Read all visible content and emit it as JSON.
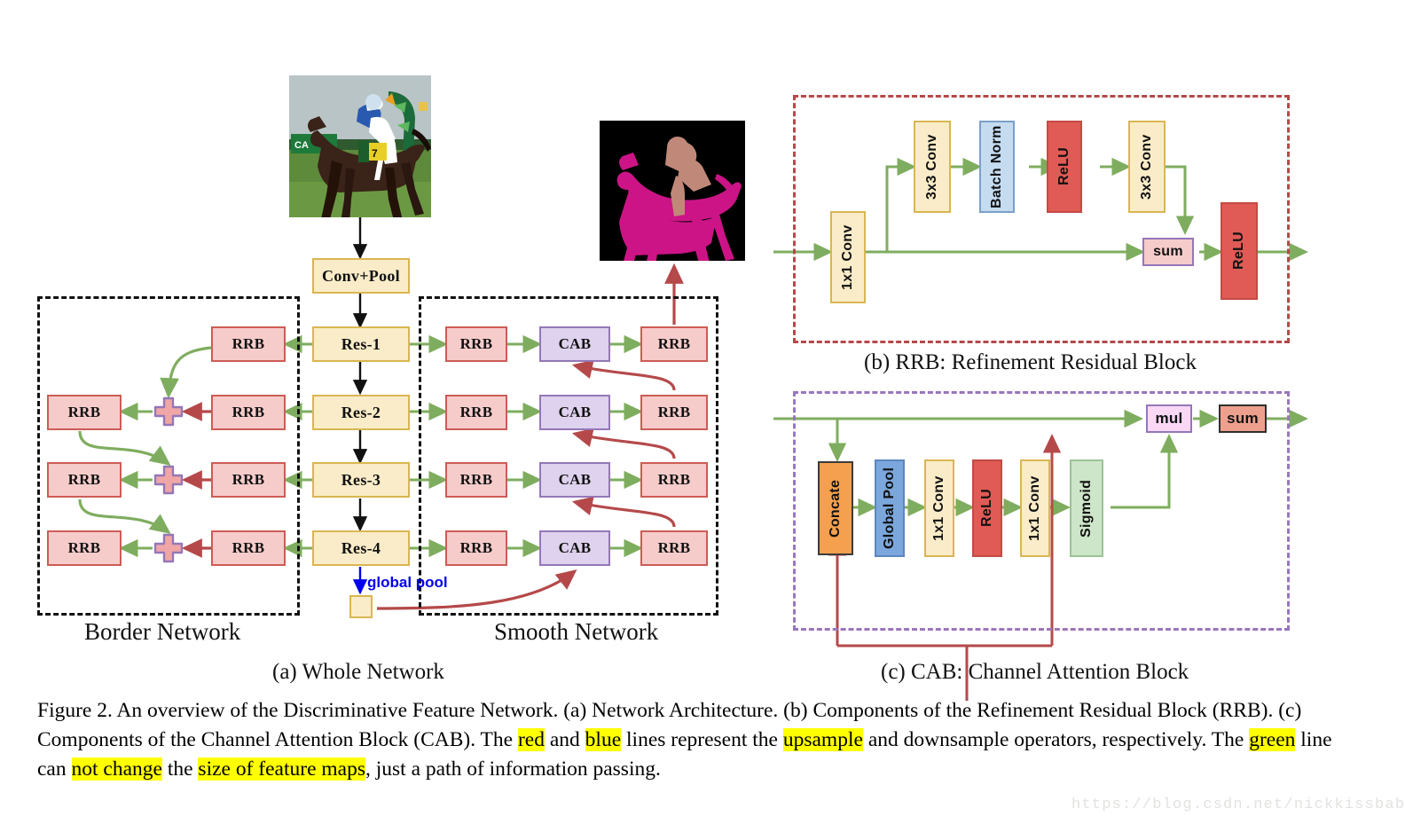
{
  "figure": {
    "caption_parts": [
      {
        "t": "Figure 2. An overview of the Discriminative Feature Network. (a) Network Architecture. (b) Components of the Refinement Residual Block (RRB). (c) Components of the Channel Attention Block (CAB). The ",
        "h": false
      },
      {
        "t": "red",
        "h": true
      },
      {
        "t": " and ",
        "h": false
      },
      {
        "t": "blue",
        "h": true
      },
      {
        "t": " lines represent the ",
        "h": false
      },
      {
        "t": "upsample",
        "h": true
      },
      {
        "t": " and downsample operators, respectively. The ",
        "h": false
      },
      {
        "t": "green",
        "h": true
      },
      {
        "t": " line can ",
        "h": false
      },
      {
        "t": "not change",
        "h": true
      },
      {
        "t": " the ",
        "h": false
      },
      {
        "t": "size of feature maps",
        "h": true
      },
      {
        "t": ", just a path of information passing.",
        "h": false
      }
    ],
    "watermark": "https://blog.csdn.net/nickkissbaby_"
  },
  "panel_a": {
    "sub_caption": "(a) Whole Network",
    "border_network_label": "Border Network",
    "smooth_network_label": "Smooth Network",
    "global_pool_label": "global pool",
    "backbone": [
      {
        "label": "Conv+Pool"
      },
      {
        "label": "Res-1"
      },
      {
        "label": "Res-2"
      },
      {
        "label": "Res-3"
      },
      {
        "label": "Res-4"
      }
    ],
    "border_rrb_col_inner": [
      "RRB",
      "RRB",
      "RRB",
      "RRB"
    ],
    "border_rrb_col_outer": [
      "RRB",
      "RRB",
      "RRB"
    ],
    "sum_symbol": "+",
    "smooth_rows": [
      {
        "rrb_in": "RRB",
        "cab": "CAB",
        "rrb_out": "RRB"
      },
      {
        "rrb_in": "RRB",
        "cab": "CAB",
        "rrb_out": "RRB"
      },
      {
        "rrb_in": "RRB",
        "cab": "CAB",
        "rrb_out": "RRB"
      },
      {
        "rrb_in": "RRB",
        "cab": "CAB",
        "rrb_out": "RRB"
      }
    ],
    "input_image_alt": "horse-and-jockey-photo",
    "output_image_alt": "horse-and-jockey-segmentation-mask"
  },
  "panel_b": {
    "sub_caption": "(b) RRB: Refinement Residual Block",
    "blocks": [
      {
        "label": "1x1 Conv",
        "color": "#faecc8"
      },
      {
        "label": "3x3 Conv",
        "color": "#faecc8"
      },
      {
        "label": "Batch Norm",
        "color": "#c5dbf0"
      },
      {
        "label": "ReLU",
        "color": "#e05b55"
      },
      {
        "label": "3x3 Conv",
        "color": "#faecc8"
      },
      {
        "label": "sum",
        "color": "#f6cccb"
      },
      {
        "label": "ReLU",
        "color": "#e05b55"
      }
    ]
  },
  "panel_c": {
    "sub_caption": "(c) CAB: Channel Attention Block",
    "blocks": [
      {
        "label": "Concate",
        "color": "#f5a04e"
      },
      {
        "label": "Global Pool",
        "color": "#7ba7dc"
      },
      {
        "label": "1x1 Conv",
        "color": "#faecc8"
      },
      {
        "label": "ReLU",
        "color": "#e05b55"
      },
      {
        "label": "1x1 Conv",
        "color": "#faecc8"
      },
      {
        "label": "Sigmoid",
        "color": "#cde5c8"
      },
      {
        "label": "mul",
        "color": "#f9d7f5"
      },
      {
        "label": "sum",
        "color": "#eda08d"
      }
    ]
  },
  "colors": {
    "green_line": "#7fad5f",
    "red_line": "#b5494a",
    "blue_line": "#0000ee",
    "black_line": "#111111",
    "highlight": "#ffff00",
    "yellow_block": "#faecc8",
    "pink_block": "#f6cccb",
    "lavender_block": "#ded2ee"
  }
}
